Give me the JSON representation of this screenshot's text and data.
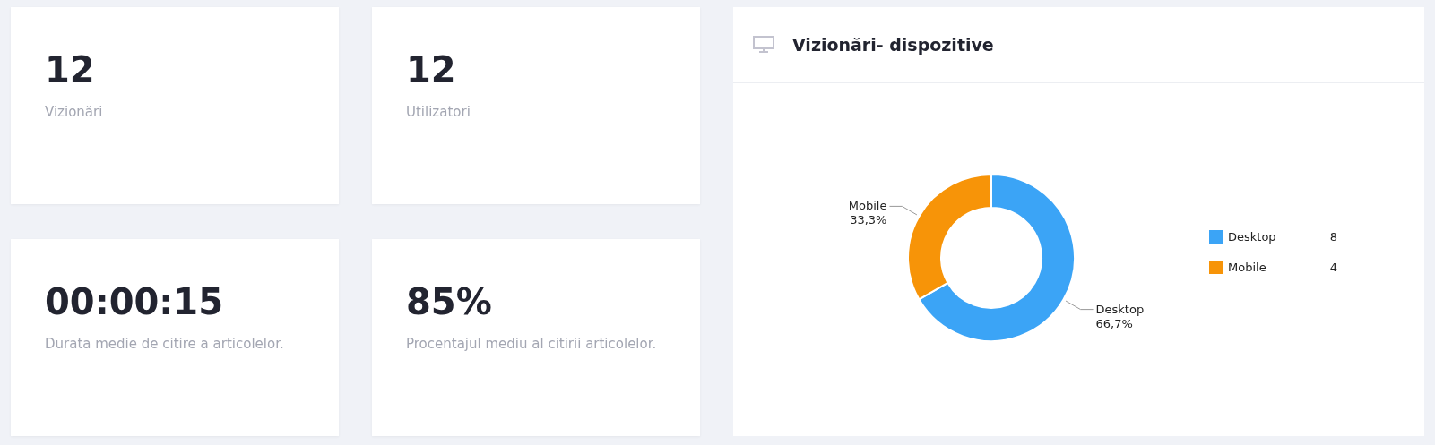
{
  "stats": [
    {
      "value": "12",
      "label": "Vizionări"
    },
    {
      "value": "12",
      "label": "Utilizatori"
    },
    {
      "value": "00:00:15",
      "label": "Durata medie de citire a articolelor."
    },
    {
      "value": "85%",
      "label": "Procentajul mediu al citirii articolelor."
    }
  ],
  "panel": {
    "title": "Vizionări- dispozitive",
    "chart_data": {
      "type": "donut",
      "categories": [
        "Desktop",
        "Mobile"
      ],
      "values": [
        66.7,
        33.3
      ],
      "value_labels": [
        "66,7%",
        "33,3%"
      ]
    },
    "legend": [
      {
        "label": "Desktop",
        "value": "8",
        "color": "#3ba4f6"
      },
      {
        "label": "Mobile",
        "value": "4",
        "color": "#f79408"
      }
    ]
  }
}
